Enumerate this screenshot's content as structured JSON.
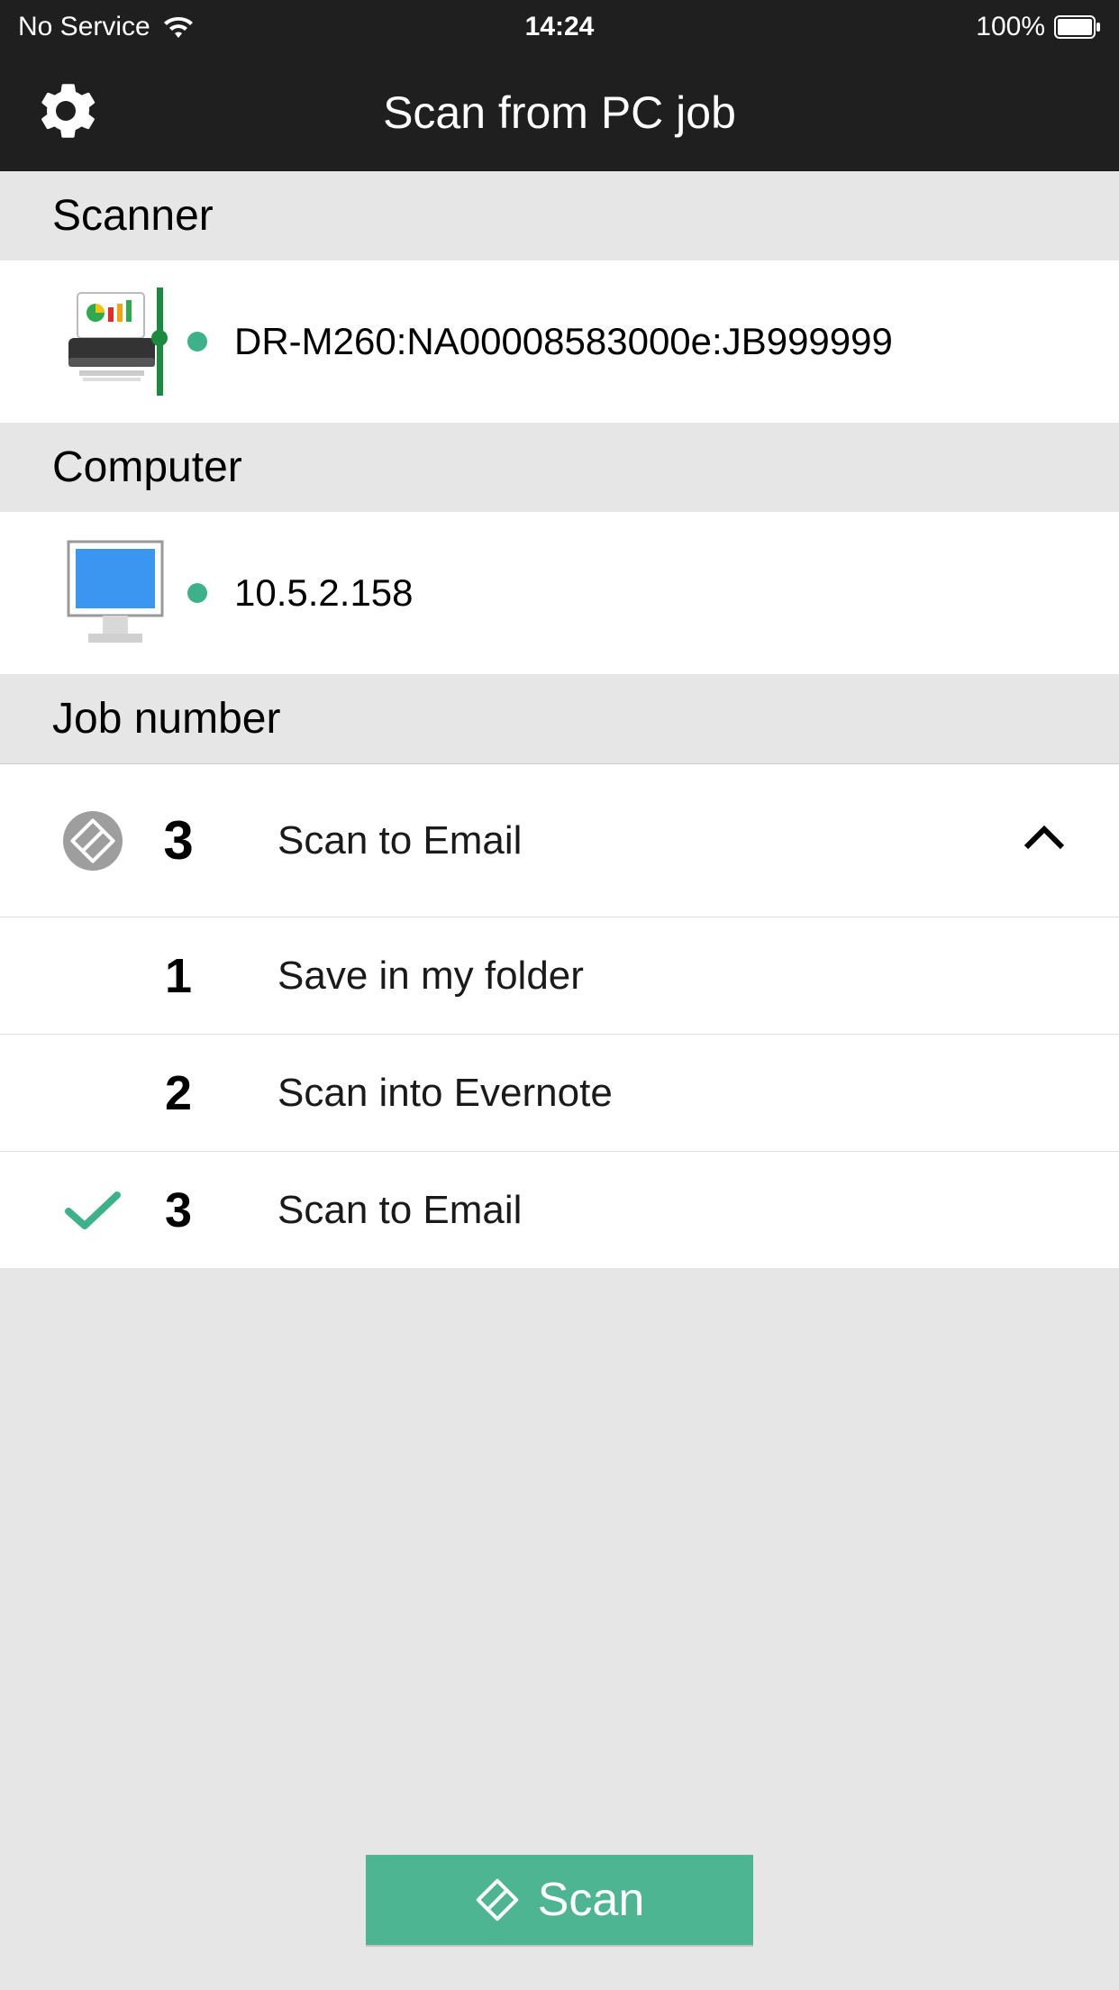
{
  "status_bar": {
    "carrier": "No Service",
    "time": "14:24",
    "battery": "100%"
  },
  "nav": {
    "title": "Scan from PC job"
  },
  "sections": {
    "scanner_header": "Scanner",
    "computer_header": "Computer",
    "job_header": "Job number"
  },
  "scanner": {
    "status_color": "#3db28a",
    "name": "DR-M260:NA00008583000e:JB999999"
  },
  "computer": {
    "status_color": "#3db28a",
    "address": "10.5.2.158"
  },
  "selected_job": {
    "number": "3",
    "label": "Scan to Email"
  },
  "jobs": [
    {
      "number": "1",
      "label": "Save in my folder",
      "checked": false
    },
    {
      "number": "2",
      "label": "Scan into Evernote",
      "checked": false
    },
    {
      "number": "3",
      "label": "Scan to Email",
      "checked": true
    }
  ],
  "scan_button": {
    "label": "Scan"
  },
  "colors": {
    "accent": "#4db592",
    "dot": "#3db28a"
  }
}
